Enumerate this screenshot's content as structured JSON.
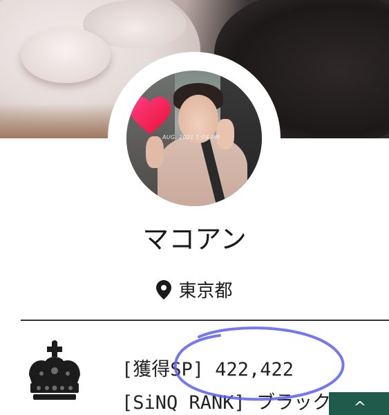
{
  "profile": {
    "display_name": "マコアン",
    "location": "東京都",
    "photo_timestamp": "AUG. 2021 1:04 PM"
  },
  "icons": {
    "location": "map-pin-icon",
    "rank_badge": "crown-icon",
    "scroll_top": "chevron-up-icon"
  },
  "stats": {
    "sp_text": "[獲得SP] 422,422",
    "rank_text": "[SiNQ RANK] ブラック"
  },
  "scroll_top": {
    "glyph": "^"
  },
  "colors": {
    "scroll_button": "#1f5a4a",
    "annotation_stroke": "#5a5ff0",
    "divider": "#333333"
  }
}
